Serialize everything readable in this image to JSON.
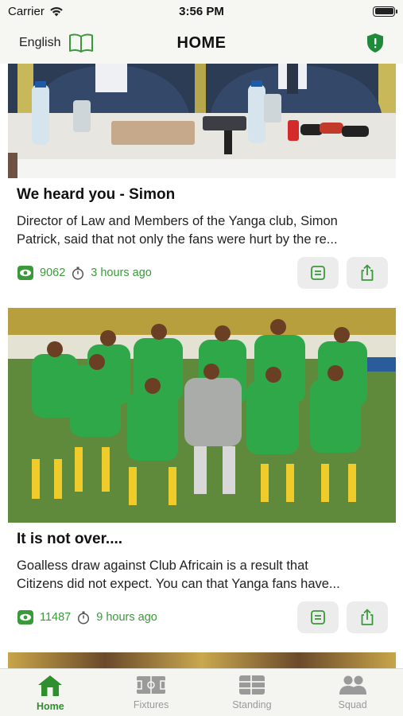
{
  "status_bar": {
    "carrier": "Carrier",
    "time": "3:56 PM"
  },
  "header": {
    "language": "English",
    "title": "HOME"
  },
  "news": [
    {
      "title": "We heard you - Simon",
      "excerpt_line1": "Director of Law and Members of the Yanga club, Simon",
      "excerpt_line2": "Patrick, said that not only the fans were hurt by the re...",
      "views": "9062",
      "time_ago": "3 hours ago"
    },
    {
      "title": "It is not over....",
      "excerpt_line1": "Goalless draw against Club Africain is a result that",
      "excerpt_line2": "Citizens did not expect. You can that Yanga fans have...",
      "views": "11487",
      "time_ago": "9 hours ago"
    }
  ],
  "tabs": [
    {
      "label": "Home",
      "icon": "home-icon",
      "active": true
    },
    {
      "label": "Fixtures",
      "icon": "pitch-icon",
      "active": false
    },
    {
      "label": "Standing",
      "icon": "table-icon",
      "active": false
    },
    {
      "label": "Squad",
      "icon": "people-icon",
      "active": false
    }
  ],
  "colors": {
    "accent": "#2f8f2f",
    "shield": "#1f8a3a",
    "stats": "#3a9a3a",
    "inactive_tab": "#9a9a9a"
  }
}
